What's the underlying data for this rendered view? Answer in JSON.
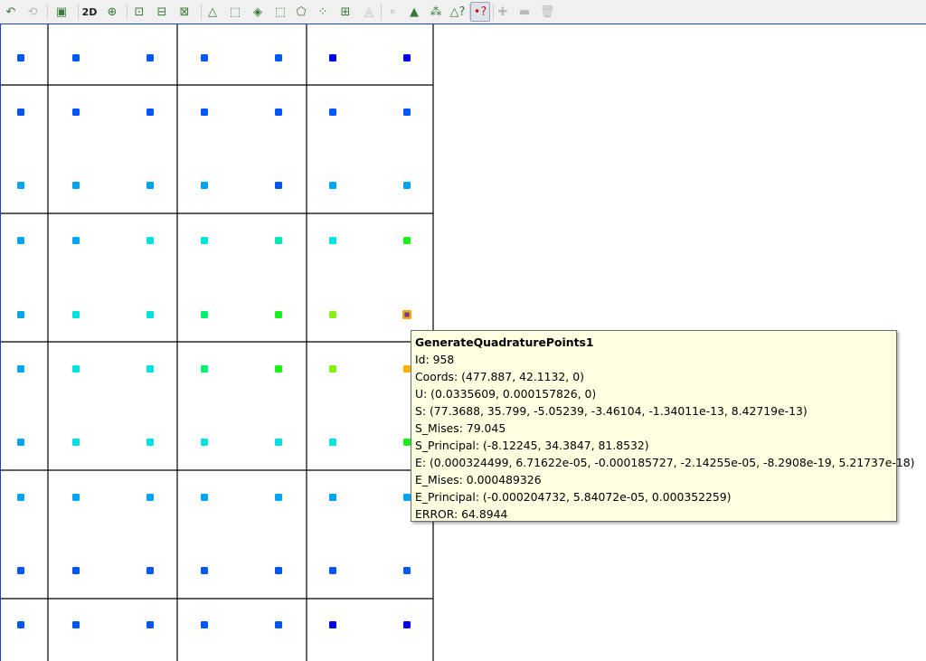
{
  "toolbar": {
    "tools": [
      {
        "icon": "reset-camera-icon",
        "glyph": "↶",
        "enabled": true
      },
      {
        "icon": "zoom-data-icon",
        "glyph": "⟲",
        "enabled": false
      },
      {
        "icon": "screenshot-icon",
        "glyph": "▣",
        "enabled": true
      },
      {
        "icon": "mode-2d-icon",
        "label": "2D",
        "enabled": true
      },
      {
        "icon": "zoom-box-icon",
        "glyph": "⊕",
        "enabled": true
      },
      {
        "icon": "select-points-icon",
        "glyph": "⊡",
        "enabled": true
      },
      {
        "icon": "select-cells-icon",
        "glyph": "⊟",
        "enabled": true
      },
      {
        "icon": "select-block-icon",
        "glyph": "⊠",
        "enabled": true
      },
      {
        "icon": "select-cells-surface-icon",
        "glyph": "△",
        "enabled": true
      },
      {
        "icon": "select-points-surface-icon",
        "glyph": "⬚",
        "enabled": true
      },
      {
        "icon": "select-frustum-icon",
        "glyph": "◈",
        "enabled": true
      },
      {
        "icon": "select-points-frustum-icon",
        "glyph": "⬚",
        "enabled": true
      },
      {
        "icon": "select-polygon-cells-icon",
        "glyph": "⬠",
        "enabled": true
      },
      {
        "icon": "select-polygon-points-icon",
        "glyph": "⁘",
        "enabled": true
      },
      {
        "icon": "interactive-select-cells-icon",
        "glyph": "⊞",
        "enabled": true
      },
      {
        "icon": "hover-cells-icon",
        "glyph": "◬",
        "enabled": false
      },
      {
        "icon": "hover-points-icon",
        "glyph": "∘",
        "enabled": false
      },
      {
        "icon": "grow-selection-icon",
        "glyph": "▲",
        "enabled": true
      },
      {
        "icon": "shrink-selection-icon",
        "glyph": "⁂",
        "enabled": true
      },
      {
        "icon": "cells-query-icon",
        "glyph": "△?",
        "enabled": true
      },
      {
        "icon": "points-query-icon",
        "glyph": "•?",
        "enabled": true,
        "active": true
      },
      {
        "icon": "plus-icon",
        "glyph": "✚",
        "enabled": false
      },
      {
        "icon": "minus-icon",
        "glyph": "▬",
        "enabled": false
      },
      {
        "icon": "trash-icon",
        "glyph": "🗑",
        "enabled": false
      }
    ]
  },
  "colors": {
    "mesh_line": "#000000",
    "background": "#ffffff",
    "selected_outline": "#f2a900",
    "selected_fill": "#7a2ea8",
    "point_blue": "#0057f5",
    "point_darkblue": "#0000e6",
    "point_lightblue": "#00a4f0",
    "point_cyan": "#00e2e0",
    "point_teal": "#00e8b4",
    "point_springgreen": "#00f070",
    "point_green": "#18f018",
    "point_lime": "#86f016",
    "point_orange": "#f8b400"
  },
  "tooltip": {
    "title": "GenerateQuadraturePoints1",
    "lines": [
      "Id: 958",
      "Coords: (477.887, 42.1132, 0)",
      "U: (0.0335609, 0.000157826, 0)",
      "S: (77.3688, 35.799, -5.05239, -3.46104, -1.34011e-13, 8.42719e-13)",
      "S_Mises: 79.045",
      "S_Principal: (-8.12245, 34.3847, 81.8532)",
      "E: (0.000324499, 6.71622e-05, -0.000185727, -2.14255e-05, -8.2908e-19, 5.21737e-18)",
      "E_Mises: 0.000489326",
      "E_Principal: (-0.000204732, 5.84072e-05, 0.000352259)",
      "ERROR: 64.8944"
    ]
  },
  "points": {
    "rows": [
      [
        "point_blue",
        "point_blue",
        "point_blue",
        "point_blue",
        "point_blue",
        "point_darkblue",
        "point_darkblue"
      ],
      [
        "point_blue",
        "point_blue",
        "point_blue",
        "point_blue",
        "point_blue",
        "point_blue",
        "point_blue"
      ],
      [
        "point_lightblue",
        "point_lightblue",
        "point_lightblue",
        "point_lightblue",
        "point_blue",
        "point_lightblue",
        "point_lightblue"
      ],
      [
        "point_lightblue",
        "point_lightblue",
        "point_cyan",
        "point_cyan",
        "point_teal",
        "point_cyan",
        "point_green"
      ],
      [
        "point_lightblue",
        "point_cyan",
        "point_cyan",
        "point_springgreen",
        "point_green",
        "point_lime",
        "selected"
      ],
      [
        "point_lightblue",
        "point_cyan",
        "point_cyan",
        "point_springgreen",
        "point_green",
        "point_lime",
        "point_orange"
      ],
      [
        "point_lightblue",
        "point_cyan",
        "point_cyan",
        "point_cyan",
        "point_cyan",
        "point_cyan",
        "point_green"
      ],
      [
        "point_lightblue",
        "point_lightblue",
        "point_lightblue",
        "point_lightblue",
        "point_lightblue",
        "point_lightblue",
        "point_lightblue"
      ],
      [
        "point_blue",
        "point_blue",
        "point_blue",
        "point_blue",
        "point_blue",
        "point_blue",
        "point_blue"
      ],
      [
        "point_blue",
        "point_blue",
        "point_blue",
        "point_blue",
        "point_blue",
        "point_darkblue",
        "point_darkblue"
      ]
    ]
  }
}
